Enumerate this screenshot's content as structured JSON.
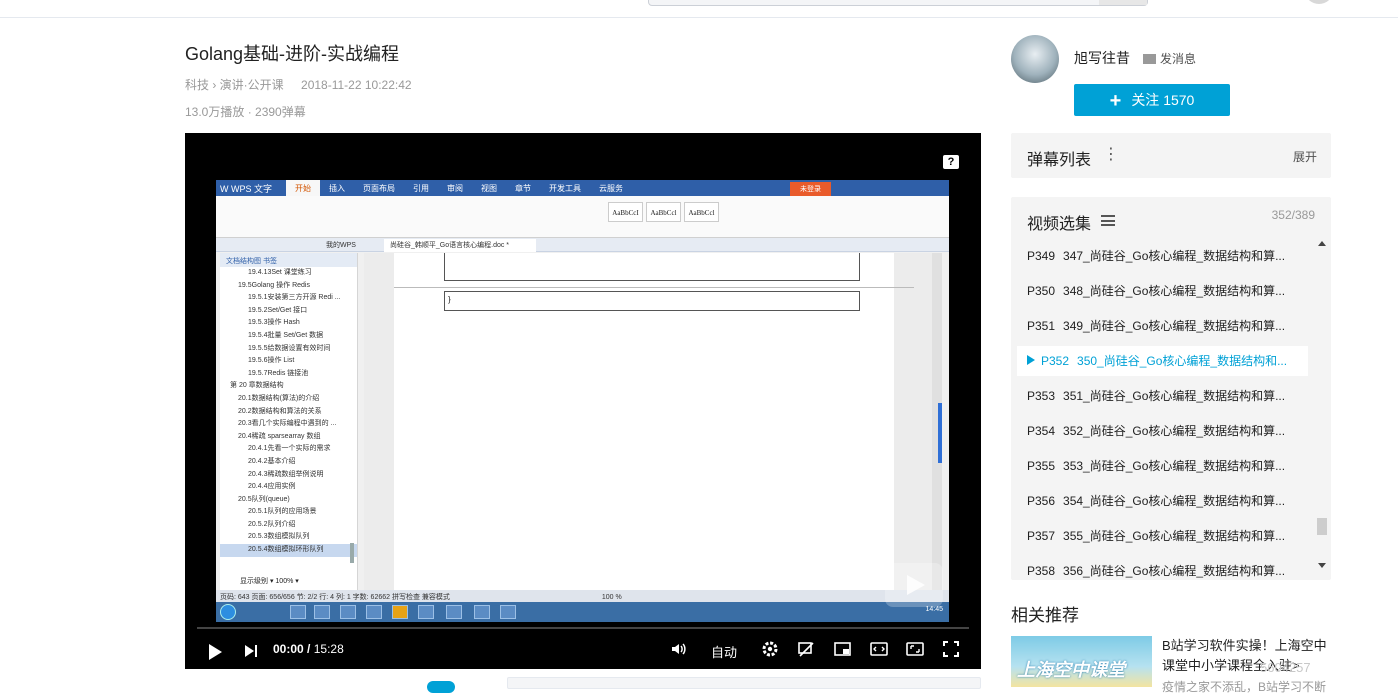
{
  "video": {
    "title": "Golang基础-进阶-实战编程",
    "category": "科技 › 演讲·公开课",
    "date": "2018-11-22 10:22:42",
    "stats": "13.0万播放 · 2390弹幕"
  },
  "player": {
    "current_time": "00:00",
    "separator": "/",
    "total_time": "15:28",
    "quality": "自动",
    "help": "?"
  },
  "screen": {
    "wps_brand": "W WPS 文字",
    "tabs": [
      "开始",
      "插入",
      "页面布局",
      "引用",
      "审阅",
      "视图",
      "章节",
      "开发工具",
      "云服务"
    ],
    "login": "未登录",
    "doc_tab": "尚硅谷_韩顺平_Go语言核心编程.doc *",
    "mywps": "我的WPS",
    "styles": [
      "AaBbCcI",
      "AaBbCcl",
      "AaBbCcl"
    ],
    "nav_tabs": "文档结构图    书签",
    "nav_items": [
      "19.4.13Set 课堂练习",
      "19.5Golang 操作 Redis",
      "19.5.1安装第三方开源 Redi ...",
      "19.5.2Set/Get 接口",
      "19.5.3操作 Hash",
      "19.5.4批量 Set/Get 数据",
      "19.5.5给数据设置有效时间",
      "19.5.6操作 List",
      "19.5.7Redis 链接池",
      "第 20 章数据结构",
      "20.1数据结构(算法)的介绍",
      "20.2数据结构和算法的关系",
      "20.3看几个实际编程中遇到的 ...",
      "20.4稀疏 sparsearray 数组",
      "20.4.1先看一个实际的需求",
      "20.4.2基本介绍",
      "20.4.3稀疏数组举例说明",
      "20.4.4应用实例",
      "20.5队列(queue)",
      "20.5.1队列的应用场景",
      "20.5.2队列介绍",
      "20.5.3数组模拟队列",
      "20.5.4数组模拟环形队列"
    ],
    "nav_bottom": "显示级别 ▾      100% ▾",
    "code_brace": "}",
    "status": "页码: 643   页面: 656/656   节: 2/2   行: 4   列: 1   字数: 62662   拼写检查   兼容模式",
    "zoom": "100 %",
    "clock": "14:45"
  },
  "uploader": {
    "name": "旭写往昔",
    "message_label": "发消息",
    "follow_label": "关注 1570"
  },
  "danmaku": {
    "title": "弹幕列表",
    "more": "⋮",
    "expand": "展开"
  },
  "episodes": {
    "title": "视频选集",
    "count": "352/389",
    "items": [
      {
        "p": "P349",
        "title": "347_尚硅谷_Go核心编程_数据结构和算..."
      },
      {
        "p": "P350",
        "title": "348_尚硅谷_Go核心编程_数据结构和算..."
      },
      {
        "p": "P351",
        "title": "349_尚硅谷_Go核心编程_数据结构和算..."
      },
      {
        "p": "P352",
        "title": "350_尚硅谷_Go核心编程_数据结构和..."
      },
      {
        "p": "P353",
        "title": "351_尚硅谷_Go核心编程_数据结构和算..."
      },
      {
        "p": "P354",
        "title": "352_尚硅谷_Go核心编程_数据结构和算..."
      },
      {
        "p": "P355",
        "title": "353_尚硅谷_Go核心编程_数据结构和算..."
      },
      {
        "p": "P356",
        "title": "354_尚硅谷_Go核心编程_数据结构和算..."
      },
      {
        "p": "P357",
        "title": "355_尚硅谷_Go核心编程_数据结构和算..."
      },
      {
        "p": "P358",
        "title": "356_尚硅谷_Go核心编程_数据结构和算..."
      }
    ],
    "current_index": 3
  },
  "related": {
    "title": "相关推荐",
    "thumb_text": "上海空中课堂",
    "item_title": "B站学习软件实操！上海空中课堂中小学课程全入驻>",
    "item_sub": "疫情之家不添乱，B站学习不断"
  },
  "watermark": "5604257"
}
